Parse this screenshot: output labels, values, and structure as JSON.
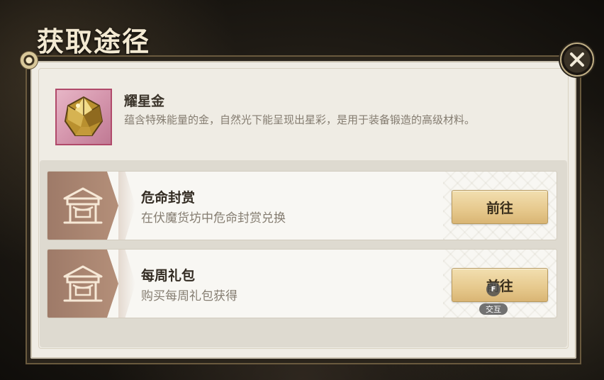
{
  "window": {
    "title": "获取途径"
  },
  "item": {
    "icon": "gold-ore-icon",
    "name": "耀星金",
    "description": "蕴含特殊能量的金，自然光下能呈现出星彩，是用于装备锻造的高级材料。"
  },
  "routes": [
    {
      "icon": "shop-icon",
      "title": "危命封赏",
      "subtitle": "在伏魔货坊中危命封赏兑换",
      "button_label": "前往"
    },
    {
      "icon": "shop-icon",
      "title": "每周礼包",
      "subtitle": "购买每周礼包获得",
      "button_label": "前往"
    }
  ],
  "interaction_hint": {
    "key": "F",
    "label": "交互"
  },
  "colors": {
    "panel_bg": "#efece4",
    "button_gold": "#e6c88c",
    "card_accent": "#b48f79",
    "item_frame": "#b04a6a"
  }
}
